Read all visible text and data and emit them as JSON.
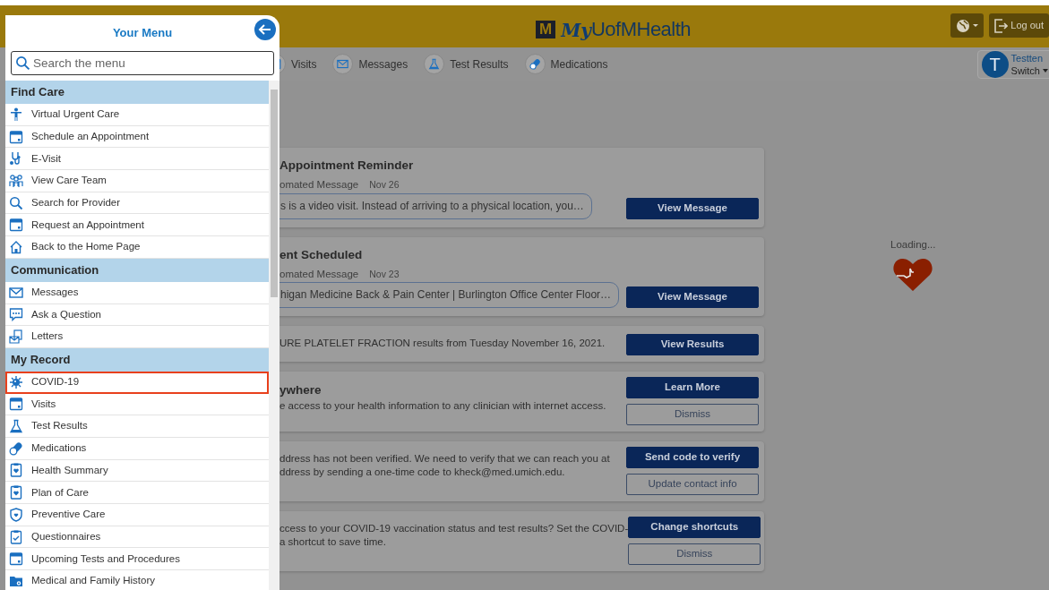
{
  "header": {
    "badge": "M",
    "logo_my": "My",
    "logo_name": "UofMHealth",
    "logout": "Log out"
  },
  "nav": {
    "items": [
      {
        "label": "Visits"
      },
      {
        "label": "Messages"
      },
      {
        "label": "Test Results"
      },
      {
        "label": "Medications"
      }
    ],
    "user": {
      "initial": "T",
      "name": "Testten",
      "switch": "Switch"
    }
  },
  "cards": [
    {
      "kind": "message",
      "title": "Appointment Reminder",
      "meta": "omated Message",
      "date": "Nov 26",
      "preview": "s is a video visit. Instead of arriving to a physical location, you…",
      "buttons": [
        {
          "label": "View Message",
          "kind": "primary"
        }
      ]
    },
    {
      "kind": "message",
      "title": "ent Scheduled",
      "meta": "omated Message",
      "date": "Nov 23",
      "preview": "higan Medicine Back & Pain Center | Burlington Office Center Floor…",
      "buttons": [
        {
          "label": "View Message",
          "kind": "primary"
        }
      ]
    },
    {
      "kind": "notice",
      "lines": [
        "URE PLATELET FRACTION results from Tuesday November 16, 2021."
      ],
      "buttons": [
        {
          "label": "View Results",
          "kind": "primary"
        }
      ]
    },
    {
      "kind": "notice",
      "title": "ywhere",
      "lines": [
        "e access to your health information to any clinician with internet access."
      ],
      "buttons": [
        {
          "label": "Learn More",
          "kind": "primary"
        },
        {
          "label": "Dismiss",
          "kind": "outline"
        }
      ]
    },
    {
      "kind": "notice",
      "lines": [
        "ddress has not been verified. We need to verify that we can reach you at",
        "ddress by sending a one-time code to kheck@med.umich.edu."
      ],
      "buttons": [
        {
          "label": "Send code to verify",
          "kind": "primary"
        },
        {
          "label": "Update contact info",
          "kind": "outline"
        }
      ]
    },
    {
      "kind": "notice",
      "lines": [
        "ccess to your COVID-19 vaccination status and test results? Set the COVID-",
        "a shortcut to save time."
      ],
      "buttons": [
        {
          "label": "Change shortcuts",
          "kind": "primary"
        },
        {
          "label": "Dismiss",
          "kind": "outline"
        }
      ]
    }
  ],
  "loading": {
    "text": "Loading..."
  },
  "menu": {
    "title": "Your Menu",
    "search": {
      "placeholder": "Search the menu"
    },
    "sections": [
      {
        "title": "Find Care",
        "items": [
          {
            "label": "Virtual Urgent Care",
            "selected": false
          },
          {
            "label": "Schedule an Appointment",
            "selected": false
          },
          {
            "label": "E-Visit",
            "selected": false
          },
          {
            "label": "View Care Team",
            "selected": false
          },
          {
            "label": "Search for Provider",
            "selected": false
          },
          {
            "label": "Request an Appointment",
            "selected": false
          },
          {
            "label": "Back to the Home Page",
            "selected": false
          }
        ]
      },
      {
        "title": "Communication",
        "items": [
          {
            "label": "Messages",
            "selected": false
          },
          {
            "label": "Ask a Question",
            "selected": false
          },
          {
            "label": "Letters",
            "selected": false
          }
        ]
      },
      {
        "title": "My Record",
        "items": [
          {
            "label": "COVID-19",
            "selected": true
          },
          {
            "label": "Visits",
            "selected": false
          },
          {
            "label": "Test Results",
            "selected": false
          },
          {
            "label": "Medications",
            "selected": false
          },
          {
            "label": "Health Summary",
            "selected": false
          },
          {
            "label": "Plan of Care",
            "selected": false
          },
          {
            "label": "Preventive Care",
            "selected": false
          },
          {
            "label": "Questionnaires",
            "selected": false
          },
          {
            "label": "Upcoming Tests and Procedures",
            "selected": false
          },
          {
            "label": "Medical and Family History",
            "selected": false
          }
        ]
      }
    ]
  }
}
